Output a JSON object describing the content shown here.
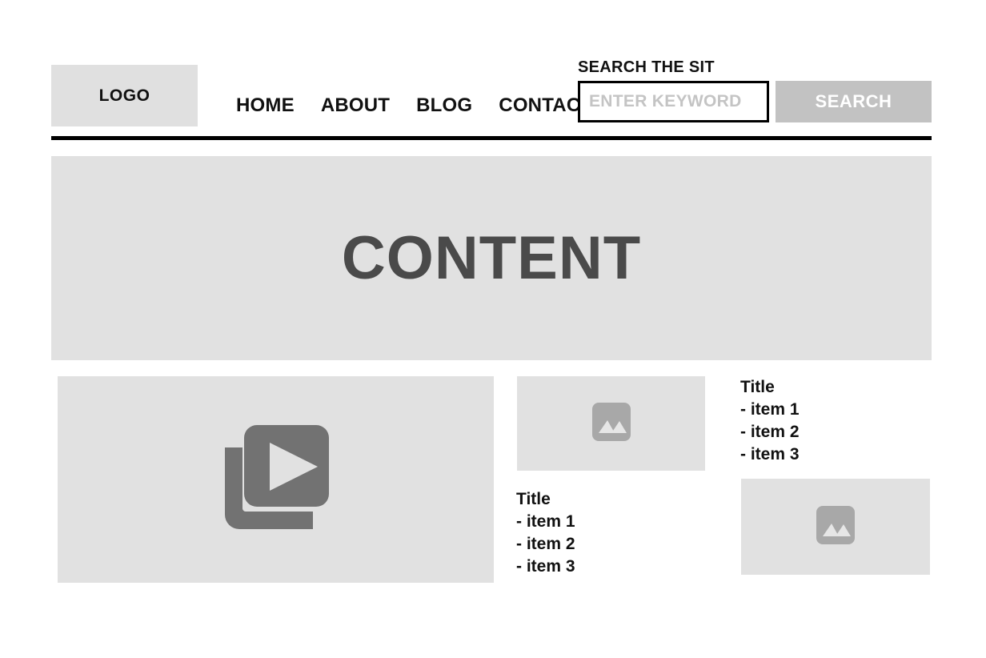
{
  "header": {
    "logo_label": "LOGO",
    "nav_items": [
      {
        "label": "HOME"
      },
      {
        "label": "ABOUT"
      },
      {
        "label": "BLOG"
      },
      {
        "label": "CONTACT"
      }
    ],
    "search": {
      "label": "SEARCH THE SIT",
      "placeholder": "ENTER KEYWORD",
      "value": "",
      "button_label": "SEARCH"
    }
  },
  "content_banner": {
    "title": "CONTENT"
  },
  "panels": {
    "video": {
      "icon": "video-play-library-icon"
    },
    "image_top": {
      "icon": "image-placeholder-icon"
    },
    "image_bottom": {
      "icon": "image-placeholder-icon"
    }
  },
  "lists": {
    "middle": {
      "title": "Title",
      "items": [
        "- item 1",
        "- item 2",
        "- item 3"
      ]
    },
    "right": {
      "title": "Title",
      "items": [
        "- item 1",
        "- item 2",
        "- item 3"
      ]
    }
  },
  "colors": {
    "panel_gray": "#e1e1e1",
    "logo_gray": "#e0e0e0",
    "button_gray": "#c2c2c2",
    "icon_gray": "#727272",
    "placeholder_gray": "#c4c4c4",
    "content_title_gray": "#4a4a4a",
    "rule_black": "#000000"
  }
}
